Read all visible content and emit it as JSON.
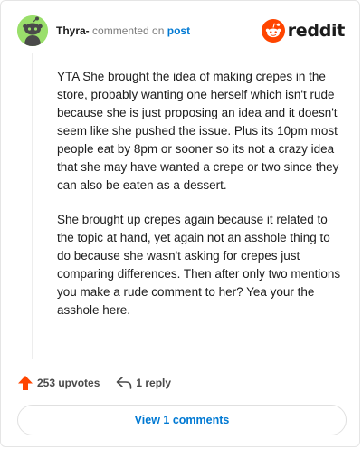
{
  "header": {
    "username": "Thyra-",
    "commented_on": "commented on",
    "post_link": "post",
    "logo_text": "reddit",
    "logo_color": "#ff4500"
  },
  "comment": {
    "paragraphs": [
      "YTA She brought the idea of making crepes in the store, probably wanting one herself which isn't rude because she is just proposing an idea and it doesn't seem like she pushed the issue. Plus its 10pm most people eat by 8pm or sooner so its not a crazy idea that she may have wanted a crepe or two since they can also be eaten as a dessert.",
      "She brought up crepes again because it related to the topic at hand, yet again not an asshole thing to do because she wasn't asking for crepes just comparing differences. Then after only two mentions you make a rude comment to her? Yea your the asshole here."
    ]
  },
  "actions": {
    "upvotes": "253 upvotes",
    "upvote_icon": "upvote-arrow-icon",
    "upvote_color": "#ff4500",
    "replies": "1 reply",
    "reply_icon": "reply-arrow-icon"
  },
  "footer": {
    "view_comments": "View 1 comments"
  },
  "colors": {
    "accent_blue": "#0079d3",
    "avatar_green": "#9adf6b"
  }
}
